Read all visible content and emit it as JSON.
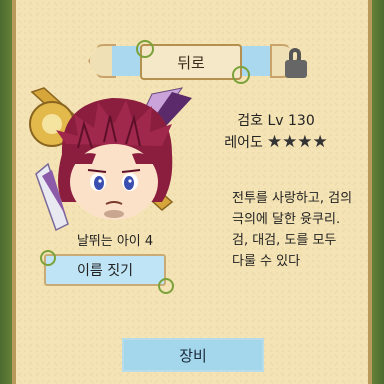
{
  "nav": {
    "back_label": "뒤로"
  },
  "character": {
    "name": "날뛰는 아이 4",
    "rename_label": "이름 짓기",
    "class_level": "검호 Lv 130",
    "rarity_label": "레어도",
    "rarity_stars": "★★★★",
    "description": [
      "전투를 사랑하고, 검의",
      "극의에 달한 윳쿠리.",
      "검, 대검, 도를 모두",
      "다룰 수 있다"
    ]
  },
  "footer": {
    "equip_label": "장비"
  },
  "colors": {
    "panel": "#f4e3b4",
    "button_blue": "#a9d8ef",
    "hair": "#8b1e3f",
    "vine": "#7ba23a"
  }
}
